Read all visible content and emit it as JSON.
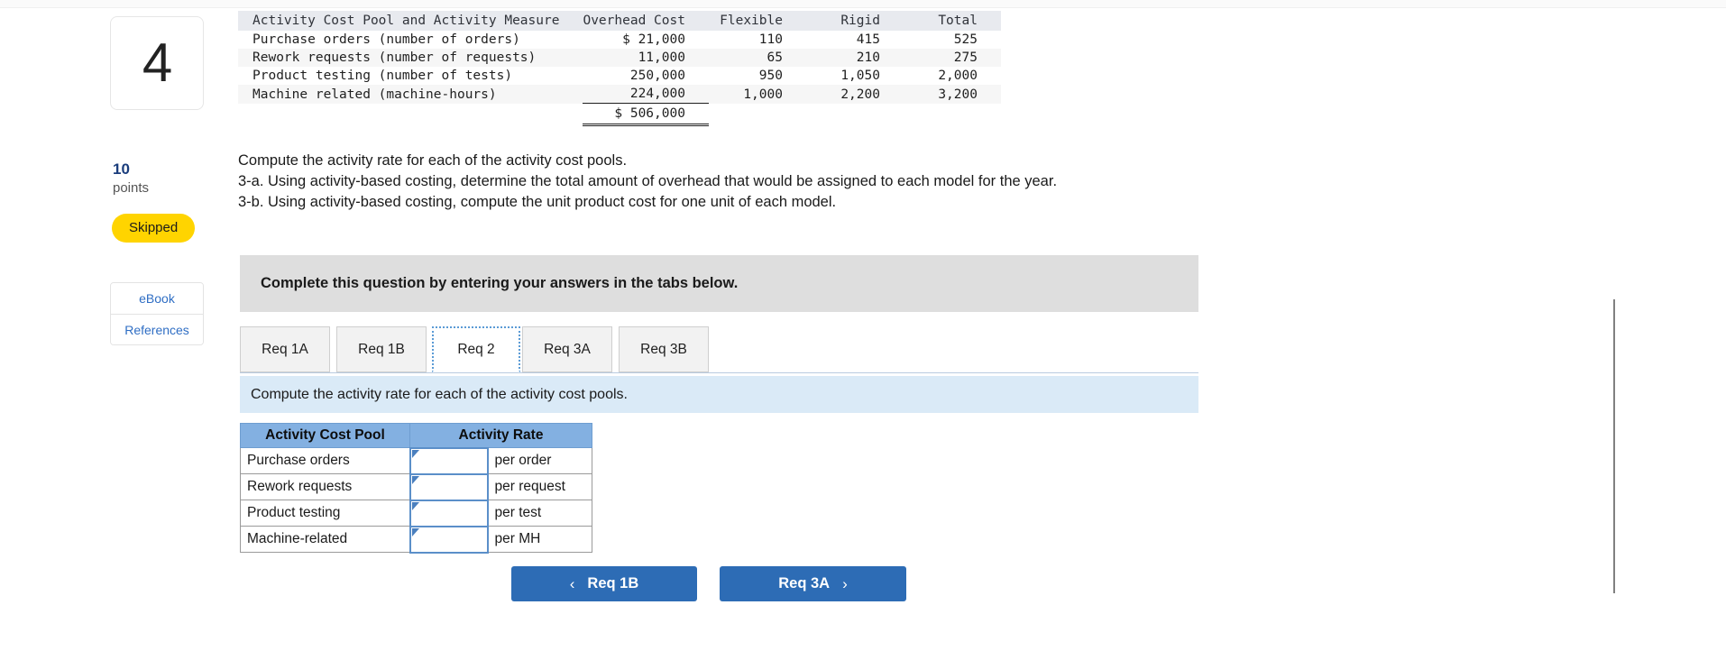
{
  "question": {
    "number": "4",
    "points_value": "10",
    "points_label": "points",
    "status_badge": "Skipped",
    "resources": [
      "eBook",
      "References"
    ]
  },
  "exhibit": {
    "columns": [
      "Activity Cost Pool and Activity Measure",
      "Overhead Cost",
      "Flexible",
      "Rigid",
      "Total"
    ],
    "rows": [
      {
        "label": "Purchase orders (number of orders)",
        "overhead_cost": "$ 21,000",
        "flexible": "110",
        "rigid": "415",
        "total": "525"
      },
      {
        "label": "Rework requests (number of requests)",
        "overhead_cost": "11,000",
        "flexible": "65",
        "rigid": "210",
        "total": "275"
      },
      {
        "label": "Product testing (number of tests)",
        "overhead_cost": "250,000",
        "flexible": "950",
        "rigid": "1,050",
        "total": "2,000"
      },
      {
        "label": "Machine related (machine-hours)",
        "overhead_cost": "224,000",
        "flexible": "1,000",
        "rigid": "2,200",
        "total": "3,200"
      }
    ],
    "total_overhead_cost": "$ 506,000"
  },
  "prose": {
    "line1": "Compute the activity rate for each of the activity cost pools.",
    "line2": "3-a. Using activity-based costing, determine the total amount of overhead that would be assigned to each model for the year.",
    "line3": "3-b. Using activity-based costing, compute the unit product cost for one unit of each model."
  },
  "instruction_banner": "Complete this question by entering your answers in the tabs below.",
  "tabs": [
    {
      "label": "Req 1A",
      "active": false
    },
    {
      "label": "Req 1B",
      "active": false
    },
    {
      "label": "Req 2",
      "active": true
    },
    {
      "label": "Req 3A",
      "active": false
    },
    {
      "label": "Req 3B",
      "active": false
    }
  ],
  "requirement_bar": "Compute the activity rate for each of the activity cost pools.",
  "answer_table": {
    "headers": [
      "Activity Cost Pool",
      "Activity Rate"
    ],
    "rows": [
      {
        "pool": "Purchase orders",
        "rate": "",
        "unit": "per order"
      },
      {
        "pool": "Rework requests",
        "rate": "",
        "unit": "per request"
      },
      {
        "pool": "Product testing",
        "rate": "",
        "unit": "per test"
      },
      {
        "pool": "Machine-related",
        "rate": "",
        "unit": "per MH"
      }
    ]
  },
  "navigation": {
    "prev_label": "Req 1B",
    "prev_icon": "chevron-left",
    "prev_glyph": "‹",
    "next_label": "Req 3A",
    "next_icon": "chevron-right",
    "next_glyph": "›"
  },
  "colors": {
    "badge_yellow": "#ffd400",
    "primary_blue": "#2d6cb5",
    "table_header_blue": "#83b0e1",
    "info_bar_blue": "#daeaf7",
    "banner_grey": "#dedede"
  }
}
